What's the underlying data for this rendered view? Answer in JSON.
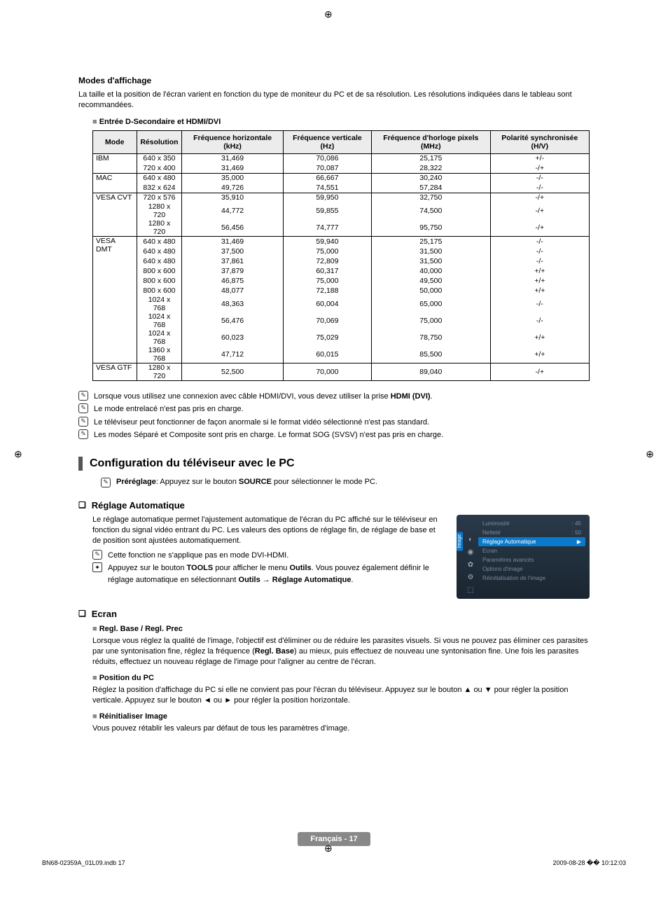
{
  "heading_modes": "Modes d'affichage",
  "intro": "La taille et la position de l'écran varient en fonction du type de moniteur du PC et de sa résolution. Les résolutions indiquées dans le tableau sont recommandées.",
  "entry_title": "Entrée D-Secondaire et HDMI/DVI",
  "table": {
    "headers": [
      "Mode",
      "Résolution",
      "Fréquence horizontale (kHz)",
      "Fréquence verticale (Hz)",
      "Fréquence d'horloge pixels (MHz)",
      "Polarité synchronisée (H/V)"
    ],
    "groups": [
      {
        "mode": "IBM",
        "rows": [
          [
            "640 x 350",
            "31,469",
            "70,086",
            "25,175",
            "+/-"
          ],
          [
            "720 x 400",
            "31,469",
            "70,087",
            "28,322",
            "-/+"
          ]
        ]
      },
      {
        "mode": "MAC",
        "rows": [
          [
            "640 x 480",
            "35,000",
            "66,667",
            "30,240",
            "-/-"
          ],
          [
            "832 x 624",
            "49,726",
            "74,551",
            "57,284",
            "-/-"
          ]
        ]
      },
      {
        "mode": "VESA CVT",
        "rows": [
          [
            "720 x 576",
            "35,910",
            "59,950",
            "32,750",
            "-/+"
          ],
          [
            "1280 x 720",
            "44,772",
            "59,855",
            "74,500",
            "-/+"
          ],
          [
            "1280 x 720",
            "56,456",
            "74,777",
            "95,750",
            "-/+"
          ]
        ]
      },
      {
        "mode": "VESA DMT",
        "rows": [
          [
            "640 x 480",
            "31,469",
            "59,940",
            "25,175",
            "-/-"
          ],
          [
            "640 x 480",
            "37,500",
            "75,000",
            "31,500",
            "-/-"
          ],
          [
            "640 x 480",
            "37,861",
            "72,809",
            "31,500",
            "-/-"
          ],
          [
            "800 x 600",
            "37,879",
            "60,317",
            "40,000",
            "+/+"
          ],
          [
            "800 x 600",
            "46,875",
            "75,000",
            "49,500",
            "+/+"
          ],
          [
            "800 x 600",
            "48,077",
            "72,188",
            "50,000",
            "+/+"
          ],
          [
            "1024 x 768",
            "48,363",
            "60,004",
            "65,000",
            "-/-"
          ],
          [
            "1024 x 768",
            "56,476",
            "70,069",
            "75,000",
            "-/-"
          ],
          [
            "1024 x 768",
            "60,023",
            "75,029",
            "78,750",
            "+/+"
          ],
          [
            "1360 x 768",
            "47,712",
            "60,015",
            "85,500",
            "+/+"
          ]
        ]
      },
      {
        "mode": "VESA GTF",
        "rows": [
          [
            "1280 x 720",
            "52,500",
            "70,000",
            "89,040",
            "-/+"
          ]
        ]
      }
    ]
  },
  "notes": [
    {
      "pre": "Lorsque vous utilisez une connexion avec câble HDMI/DVI, vous devez utiliser la prise ",
      "bold": "HDMI (DVI)",
      "post": "."
    },
    {
      "pre": "Le mode entrelacé n'est pas pris en charge.",
      "bold": "",
      "post": ""
    },
    {
      "pre": "Le téléviseur peut fonctionner de façon anormale si le format vidéo sélectionné n'est pas standard.",
      "bold": "",
      "post": ""
    },
    {
      "pre": "Les modes Séparé et Composite sont pris en charge. Le format SOG (SVSV) n'est pas pris en charge.",
      "bold": "",
      "post": ""
    }
  ],
  "config_title": "Configuration du téléviseur avec le PC",
  "prereg": {
    "boldA": "Préréglage",
    "mid": ": Appuyez sur le bouton ",
    "boldB": "SOURCE",
    "post": " pour sélectionner le mode PC."
  },
  "reglage": {
    "title": "Réglage Automatique",
    "p1": "Le réglage automatique permet l'ajustement automatique de l'écran du PC affiché sur le téléviseur en fonction du signal vidéo entrant du PC. Les valeurs des options de réglage fin, de réglage de base et de position sont ajustées automatiquement.",
    "n1": "Cette fonction ne s'applique pas en mode DVI-HDMI.",
    "n2a": "Appuyez sur le bouton ",
    "n2b": "TOOLS",
    "n2c": " pour afficher le menu ",
    "n2d": "Outils",
    "n2e": ". Vous pouvez également définir le réglage automatique en sélectionnant ",
    "n2f": "Outils → Réglage Automatique",
    "n2g": "."
  },
  "osd": {
    "tab": "Image",
    "rows": [
      {
        "l": "Luminosité",
        "r": ": 45"
      },
      {
        "l": "Netteté",
        "r": ": 50"
      },
      {
        "l": "Réglage Automatique",
        "r": "▶",
        "hl": true
      },
      {
        "l": "Ecran",
        "r": ""
      },
      {
        "l": "Paramètres avancés",
        "r": ""
      },
      {
        "l": "Options d'image",
        "r": ""
      },
      {
        "l": "Réinitialisation de l'image",
        "r": ""
      }
    ]
  },
  "ecran": {
    "title": "Ecran",
    "s1t": "Regl. Base / Regl. Prec",
    "s1p_a": "Lorsque vous réglez la qualité de l'image, l'objectif est d'éliminer ou de réduire les parasites visuels. Si vous ne pouvez pas éliminer ces parasites par une syntonisation fine, réglez la fréquence (",
    "s1p_b": "Regl. Base",
    "s1p_c": ") au mieux, puis effectuez de nouveau une syntonisation fine. Une fois les parasites réduits, effectuez un nouveau réglage de l'image pour l'aligner au centre de l'écran.",
    "s2t": "Position du PC",
    "s2p": "Réglez la position d'affichage du PC si elle ne convient pas pour l'écran du téléviseur. Appuyez sur le bouton ▲ ou ▼ pour régler la position verticale. Appuyez sur le bouton ◄ ou ► pour régler la position horizontale.",
    "s3t": "Réinitialiser Image",
    "s3p": "Vous pouvez rétablir les valeurs par défaut de tous les paramètres d'image."
  },
  "footer_page": "Français - 17",
  "print_file": "BN68-02359A_01L09.indb   17",
  "print_time": "2009-08-28   �� 10:12:03"
}
